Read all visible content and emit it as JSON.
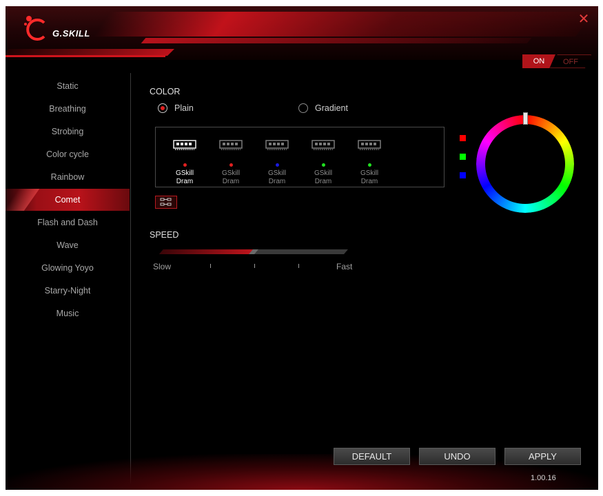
{
  "header": {
    "logo_text": "G.SKILL",
    "close_glyph": "✕"
  },
  "power": {
    "on_label": "ON",
    "off_label": "OFF",
    "state": "on"
  },
  "sidebar": {
    "items": [
      {
        "label": "Static",
        "active": false
      },
      {
        "label": "Breathing",
        "active": false
      },
      {
        "label": "Strobing",
        "active": false
      },
      {
        "label": "Color cycle",
        "active": false
      },
      {
        "label": "Rainbow",
        "active": false
      },
      {
        "label": "Comet",
        "active": true
      },
      {
        "label": "Flash and Dash",
        "active": false
      },
      {
        "label": "Wave",
        "active": false
      },
      {
        "label": "Glowing Yoyo",
        "active": false
      },
      {
        "label": "Starry-Night",
        "active": false
      },
      {
        "label": "Music",
        "active": false
      }
    ]
  },
  "color": {
    "section_label": "COLOR",
    "mode_plain": "Plain",
    "mode_gradient": "Gradient",
    "selected_mode": "Plain",
    "devices": [
      {
        "line1": "GSkill",
        "line2": "Dram",
        "dot_color": "#e02020",
        "selected": true
      },
      {
        "line1": "GSkill",
        "line2": "Dram",
        "dot_color": "#e02020",
        "selected": false
      },
      {
        "line1": "GSkill",
        "line2": "Dram",
        "dot_color": "#1a1ae0",
        "selected": false
      },
      {
        "line1": "GSkill",
        "line2": "Dram",
        "dot_color": "#20e020",
        "selected": false
      },
      {
        "line1": "GSkill",
        "line2": "Dram",
        "dot_color": "#20e020",
        "selected": false
      }
    ],
    "swatches": [
      {
        "name": "red",
        "color": "#ff0000"
      },
      {
        "name": "green",
        "color": "#00ff00"
      },
      {
        "name": "blue",
        "color": "#0000ff"
      }
    ]
  },
  "speed": {
    "section_label": "SPEED",
    "slow_label": "Slow",
    "fast_label": "Fast",
    "level": 0.5
  },
  "footer": {
    "default_label": "DEFAULT",
    "undo_label": "UNDO",
    "apply_label": "APPLY",
    "version": "1.00.16"
  }
}
